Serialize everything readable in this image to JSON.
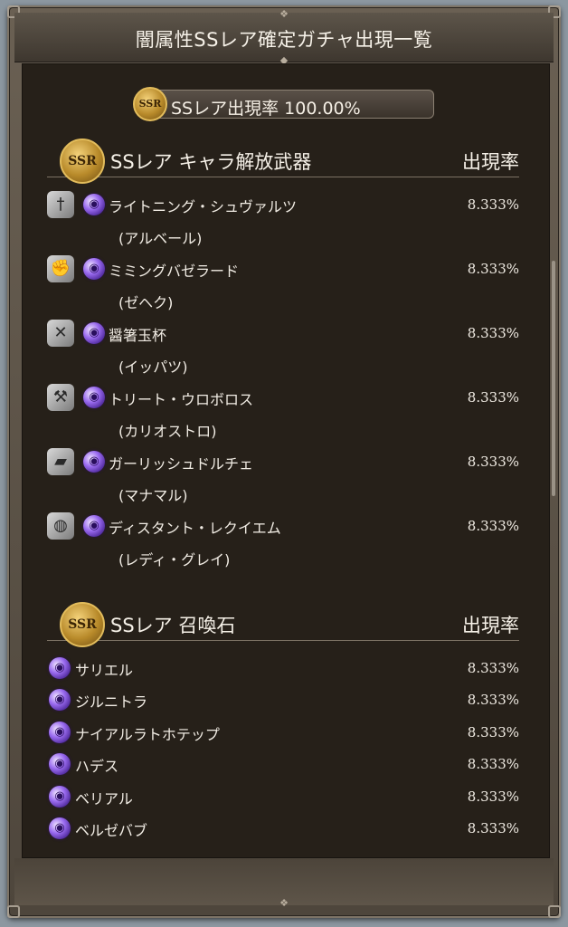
{
  "title": "闇属性SSレア確定ガチャ出現一覧",
  "rate_pill": {
    "badge": "SSR",
    "text": "SSレア出現率 100.00%"
  },
  "weapons_section": {
    "badge": "SSR",
    "title": "SSレア キャラ解放武器",
    "rate_header": "出現率",
    "items": [
      {
        "icon": "sword-icon",
        "name": "ライトニング・シュヴァルツ",
        "character": "(アルベール)",
        "rate": "8.333%"
      },
      {
        "icon": "fist-icon",
        "name": "ミミングバゼラード",
        "character": "(ゼヘク)",
        "rate": "8.333%"
      },
      {
        "icon": "dagger-icon",
        "name": "醤箸玉杯",
        "character": "(イッパツ)",
        "rate": "8.333%"
      },
      {
        "icon": "staff-icon",
        "name": "トリート・ウロボロス",
        "character": "(カリオストロ)",
        "rate": "8.333%"
      },
      {
        "icon": "gun-icon",
        "name": "ガーリッシュドルチェ",
        "character": "(マナマル)",
        "rate": "8.333%"
      },
      {
        "icon": "gauntlet-icon",
        "name": "ディスタント・レクイエム",
        "character": "(レディ・グレイ)",
        "rate": "8.333%"
      }
    ]
  },
  "summons_section": {
    "badge": "SSR",
    "title": "SSレア 召喚石",
    "rate_header": "出現率",
    "items": [
      {
        "name": "サリエル",
        "rate": "8.333%"
      },
      {
        "name": "ジルニトラ",
        "rate": "8.333%"
      },
      {
        "name": "ナイアルラトホテップ",
        "rate": "8.333%"
      },
      {
        "name": "ハデス",
        "rate": "8.333%"
      },
      {
        "name": "ベリアル",
        "rate": "8.333%"
      },
      {
        "name": "ベルゼバブ",
        "rate": "8.333%"
      }
    ]
  },
  "colors": {
    "panel_bg": "#262019",
    "frame": "#6a6053",
    "dark_orb": "#9b6cf0",
    "gold": "#d2a84a"
  }
}
